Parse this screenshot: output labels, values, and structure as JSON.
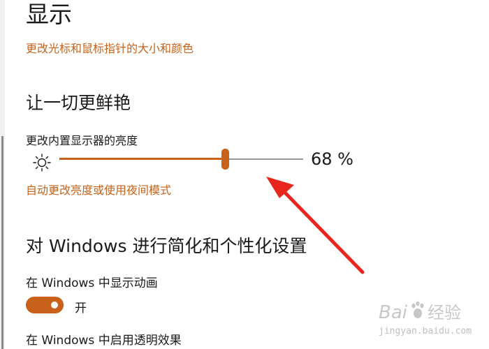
{
  "page": {
    "title": "显示",
    "cursor_link": "更改光标和鼠标指针的大小和颜色"
  },
  "brightness_section": {
    "heading": "让一切更鲜艳",
    "label": "更改内置显示器的亮度",
    "value": 68,
    "value_text": "68 %",
    "icon": "sun-icon",
    "night_link": "自动更改亮度或使用夜间模式"
  },
  "simplify_section": {
    "heading": "对 Windows 进行简化和个性化设置",
    "animation_label": "在 Windows 中显示动画",
    "animation_toggle_state": "开",
    "transparency_label": "在 Windows 中启用透明效果"
  },
  "watermark": {
    "logo_text": "Baidu经验",
    "url": "jingyan.baidu.com"
  },
  "colors": {
    "accent": "#c8621a",
    "annotation_arrow": "#e8261e"
  }
}
